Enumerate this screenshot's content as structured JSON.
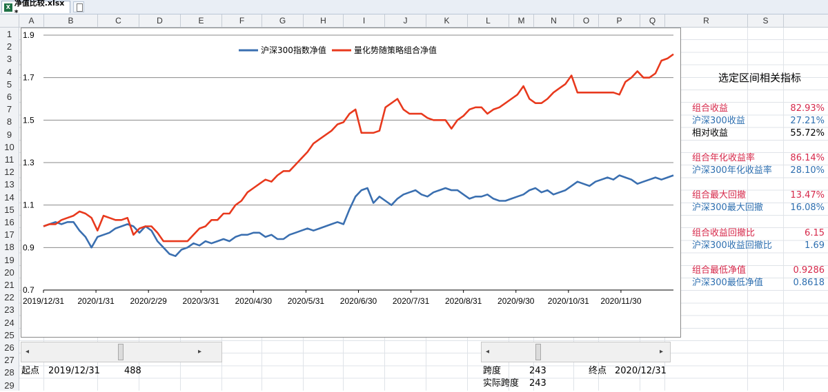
{
  "window": {
    "tab_title": "净值比较.xlsx *"
  },
  "columns": [
    "A",
    "B",
    "C",
    "D",
    "E",
    "F",
    "G",
    "H",
    "I",
    "J",
    "K",
    "L",
    "M",
    "N",
    "O",
    "P",
    "Q",
    "R",
    "S"
  ],
  "rows": [
    "1",
    "2",
    "3",
    "4",
    "5",
    "6",
    "7",
    "8",
    "9",
    "10",
    "11",
    "12",
    "13",
    "14",
    "15",
    "16",
    "17",
    "18",
    "19",
    "20",
    "21",
    "22",
    "23",
    "24",
    "25",
    "26",
    "27",
    "28",
    "29"
  ],
  "colors": {
    "index": "#3a6fb0",
    "portfolio": "#e8391d",
    "red_text": "#d6284a",
    "blue_text": "#2e6fb0"
  },
  "chart_data": {
    "type": "line",
    "legend": [
      "沪深300指数净值",
      "量化势随策略组合净值"
    ],
    "ylim": [
      0.7,
      1.9
    ],
    "yticks": [
      "0.7",
      "0.9",
      "1.1",
      "1.3",
      "1.5",
      "1.7",
      "1.9"
    ],
    "xticks": [
      "2019/12/31",
      "2020/1/31",
      "2020/2/29",
      "2020/3/31",
      "2020/4/30",
      "2020/5/31",
      "2020/6/30",
      "2020/7/31",
      "2020/8/31",
      "2020/9/30",
      "2020/10/31",
      "2020/11/30"
    ],
    "grid": true,
    "legend_position": "top-center",
    "series": [
      {
        "name": "沪深300指数净值",
        "values": [
          1.0,
          1.01,
          1.02,
          1.01,
          1.02,
          1.02,
          0.98,
          0.95,
          0.9,
          0.95,
          0.96,
          0.97,
          0.99,
          1.0,
          1.01,
          1.0,
          0.97,
          1.0,
          0.98,
          0.93,
          0.9,
          0.87,
          0.86,
          0.89,
          0.9,
          0.92,
          0.91,
          0.93,
          0.92,
          0.93,
          0.94,
          0.93,
          0.95,
          0.96,
          0.96,
          0.97,
          0.97,
          0.95,
          0.96,
          0.94,
          0.94,
          0.96,
          0.97,
          0.98,
          0.99,
          0.98,
          0.99,
          1.0,
          1.01,
          1.02,
          1.01,
          1.08,
          1.14,
          1.17,
          1.18,
          1.11,
          1.14,
          1.12,
          1.1,
          1.13,
          1.15,
          1.16,
          1.17,
          1.15,
          1.14,
          1.16,
          1.17,
          1.18,
          1.17,
          1.17,
          1.15,
          1.13,
          1.14,
          1.14,
          1.15,
          1.13,
          1.12,
          1.12,
          1.13,
          1.14,
          1.15,
          1.17,
          1.18,
          1.16,
          1.17,
          1.15,
          1.16,
          1.17,
          1.19,
          1.21,
          1.2,
          1.19,
          1.21,
          1.22,
          1.23,
          1.22,
          1.24,
          1.23,
          1.22,
          1.2,
          1.21,
          1.22,
          1.23,
          1.22,
          1.23,
          1.24
        ]
      },
      {
        "name": "量化势随策略组合净值",
        "values": [
          1.0,
          1.01,
          1.01,
          1.03,
          1.04,
          1.05,
          1.07,
          1.06,
          1.04,
          0.98,
          1.05,
          1.04,
          1.03,
          1.03,
          1.04,
          0.96,
          0.99,
          1.0,
          1.0,
          0.97,
          0.93,
          0.93,
          0.93,
          0.93,
          0.93,
          0.96,
          0.99,
          1.0,
          1.03,
          1.03,
          1.06,
          1.06,
          1.1,
          1.12,
          1.16,
          1.18,
          1.2,
          1.22,
          1.21,
          1.24,
          1.26,
          1.26,
          1.29,
          1.32,
          1.35,
          1.39,
          1.41,
          1.43,
          1.45,
          1.48,
          1.49,
          1.53,
          1.55,
          1.44,
          1.44,
          1.44,
          1.45,
          1.56,
          1.58,
          1.6,
          1.55,
          1.53,
          1.53,
          1.53,
          1.51,
          1.5,
          1.5,
          1.5,
          1.46,
          1.5,
          1.52,
          1.55,
          1.56,
          1.56,
          1.53,
          1.55,
          1.56,
          1.58,
          1.6,
          1.62,
          1.66,
          1.6,
          1.58,
          1.58,
          1.6,
          1.63,
          1.65,
          1.67,
          1.71,
          1.63,
          1.63,
          1.63,
          1.63,
          1.63,
          1.63,
          1.63,
          1.62,
          1.68,
          1.7,
          1.73,
          1.7,
          1.7,
          1.72,
          1.78,
          1.79,
          1.81
        ]
      }
    ]
  },
  "metrics": {
    "title": "选定区间相关指标",
    "items": [
      {
        "label": "组合收益",
        "value": "82.93%",
        "color": "red"
      },
      {
        "label": "沪深300收益",
        "value": "27.21%",
        "color": "blue"
      },
      {
        "label": "相对收益",
        "value": "55.72%",
        "color": "black"
      },
      {
        "label": "组合年化收益率",
        "value": "86.14%",
        "color": "red"
      },
      {
        "label": "沪深300年化收益率",
        "value": "28.10%",
        "color": "blue"
      },
      {
        "label": "组合最大回撤",
        "value": "13.47%",
        "color": "red"
      },
      {
        "label": "沪深300最大回撤",
        "value": "16.08%",
        "color": "blue"
      },
      {
        "label": "组合收益回撤比",
        "value": "6.15",
        "color": "red"
      },
      {
        "label": "沪深300收益回撤比",
        "value": "1.69",
        "color": "blue"
      },
      {
        "label": "组合最低净值",
        "value": "0.9286",
        "color": "red"
      },
      {
        "label": "沪深300最低净值",
        "value": "0.8618",
        "color": "blue"
      }
    ]
  },
  "controls": {
    "start_label": "起点",
    "start_date": "2019/12/31",
    "start_value": "488",
    "span_label": "跨度",
    "span_value": "243",
    "actual_span_label": "实际跨度",
    "actual_span_value": "243",
    "end_label": "终点",
    "end_date": "2020/12/31"
  }
}
